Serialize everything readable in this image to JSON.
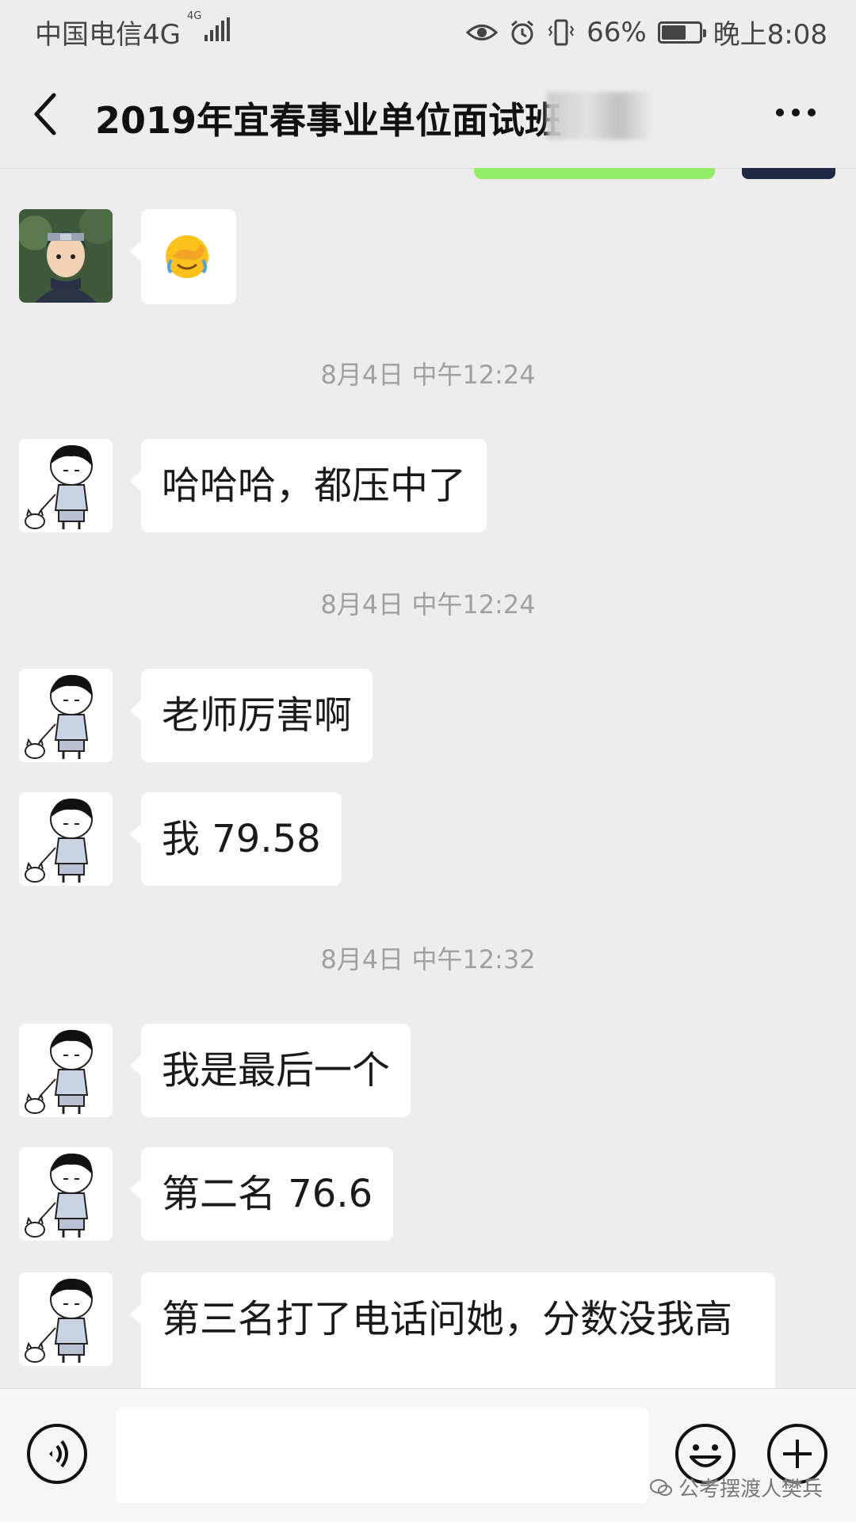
{
  "status_bar": {
    "carrier": "中国电信4G",
    "network_small": "4G",
    "battery_percent": "66%",
    "battery_level": 0.66,
    "time": "晚上8:08"
  },
  "header": {
    "title": "2019年宜春事业单位面试班",
    "icons": [
      "back-arrow-icon",
      "more-icon"
    ]
  },
  "messages": [
    {
      "type": "emoji",
      "avatar": "ninja-avatar",
      "emoji": "facepalm-tears"
    },
    {
      "type": "timestamp",
      "text": "8月4日 中午12:24"
    },
    {
      "type": "text",
      "avatar": "cartoon-boy-avatar",
      "text": "哈哈哈，都压中了"
    },
    {
      "type": "timestamp",
      "text": "8月4日 中午12:24"
    },
    {
      "type": "text",
      "avatar": "cartoon-boy-avatar",
      "text": "老师厉害啊"
    },
    {
      "type": "text",
      "avatar": "cartoon-boy-avatar",
      "text": "我 79.58"
    },
    {
      "type": "timestamp",
      "text": "8月4日 中午12:32"
    },
    {
      "type": "text",
      "avatar": "cartoon-boy-avatar",
      "text": "我是最后一个"
    },
    {
      "type": "text",
      "avatar": "cartoon-boy-avatar",
      "text": "第二名 76.6"
    },
    {
      "type": "text",
      "avatar": "cartoon-boy-avatar",
      "text": "第三名打了电话问她，分数没我高"
    }
  ],
  "input_bar": {
    "icons": [
      "voice-icon",
      "emoji-icon",
      "plus-icon"
    ],
    "text_value": ""
  },
  "watermark": "公考摆渡人樊兵",
  "colors": {
    "background": "#ededed",
    "bubble": "#ffffff",
    "self_bubble": "#95ec69",
    "timestamp": "#a0a0a0"
  }
}
